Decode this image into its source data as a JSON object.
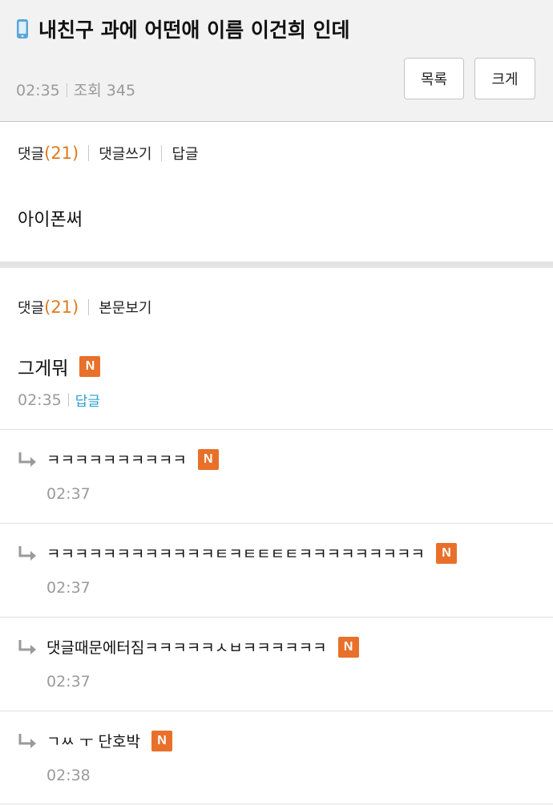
{
  "post": {
    "title": "내친구 과에 어떤애 이름 이건희 인데",
    "time": "02:35",
    "views_label": "조회 345",
    "list_button": "목록",
    "large_button": "크게"
  },
  "section1": {
    "comments_label": "댓글",
    "comments_count": "(21)",
    "write_comment": "댓글쓰기",
    "reply": "답글",
    "body": "아이폰써"
  },
  "section2": {
    "comments_label": "댓글",
    "comments_count": "(21)",
    "view_post": "본문보기"
  },
  "comment": {
    "author": "그게뭐",
    "badge": "N",
    "time": "02:35",
    "reply": "답글"
  },
  "replies": [
    {
      "text": "ㅋㅋㅋㅋㅋㅋㅋㅋㅋㅋ",
      "badge": "N",
      "time": "02:37"
    },
    {
      "text": "ㅋㅋㅋㅋㅋㅋㅋㅋㅋㅋㅋㅋㅌㅋㅌㅌㅌㅌㅋㅋㅋㅋㅋㅋㅋㅋㅋ",
      "badge": "N",
      "time": "02:37"
    },
    {
      "text": "댓글때문에터짐ㅋㅋㅋㅋㅋㅅㅂㅋㅋㅋㅋㅋㅋ",
      "badge": "N",
      "time": "02:37"
    },
    {
      "text": "ㄱㅆ ㅜ 단호박",
      "badge": "N",
      "time": "02:38"
    }
  ],
  "colors": {
    "accent_orange": "#e8702a",
    "count_orange": "#e07a1f",
    "reply_blue": "#2a9ed4"
  }
}
